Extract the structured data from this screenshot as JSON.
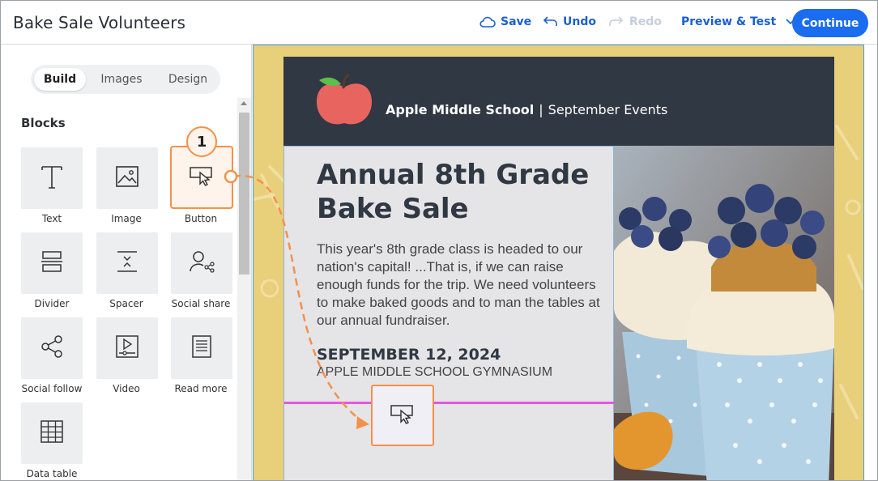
{
  "header": {
    "title": "Bake Sale Volunteers",
    "save": "Save",
    "undo": "Undo",
    "redo": "Redo",
    "preview": "Preview & Test",
    "continue": "Continue"
  },
  "sidebar": {
    "tabs": [
      "Build",
      "Images",
      "Design"
    ],
    "active_tab": "Build",
    "blocks_heading": "Blocks",
    "blocks": [
      {
        "label": "Text",
        "icon": "text-icon"
      },
      {
        "label": "Image",
        "icon": "image-icon"
      },
      {
        "label": "Button",
        "icon": "button-cursor-icon"
      },
      {
        "label": "Divider",
        "icon": "divider-icon"
      },
      {
        "label": "Spacer",
        "icon": "spacer-icon"
      },
      {
        "label": "Social share",
        "icon": "social-share-icon"
      },
      {
        "label": "Social follow",
        "icon": "social-follow-icon"
      },
      {
        "label": "Video",
        "icon": "video-icon"
      },
      {
        "label": "Read more",
        "icon": "read-more-icon"
      },
      {
        "label": "Data table",
        "icon": "data-table-icon"
      }
    ]
  },
  "callout": "1",
  "email": {
    "school_name": "Apple Middle School",
    "separator": "|",
    "header_subtitle": "September Events",
    "headline_line1": "Annual 8th Grade",
    "headline_line2": "Bake Sale",
    "body": "This year's 8th grade class is headed to our nation's capital! ...That is, if we can raise enough funds for the trip. We need volunteers to make baked goods and to man the tables at our annual fundraiser.",
    "date": "SEPTEMBER 12, 2024",
    "location": "APPLE MIDDLE SCHOOL GYMNASIUM"
  },
  "colors": {
    "accent": "#1a6cf0",
    "highlight": "#f5904a",
    "drop_line": "#e855e0",
    "canvas_bg": "#e8cf7a",
    "email_header": "#2f3843"
  }
}
